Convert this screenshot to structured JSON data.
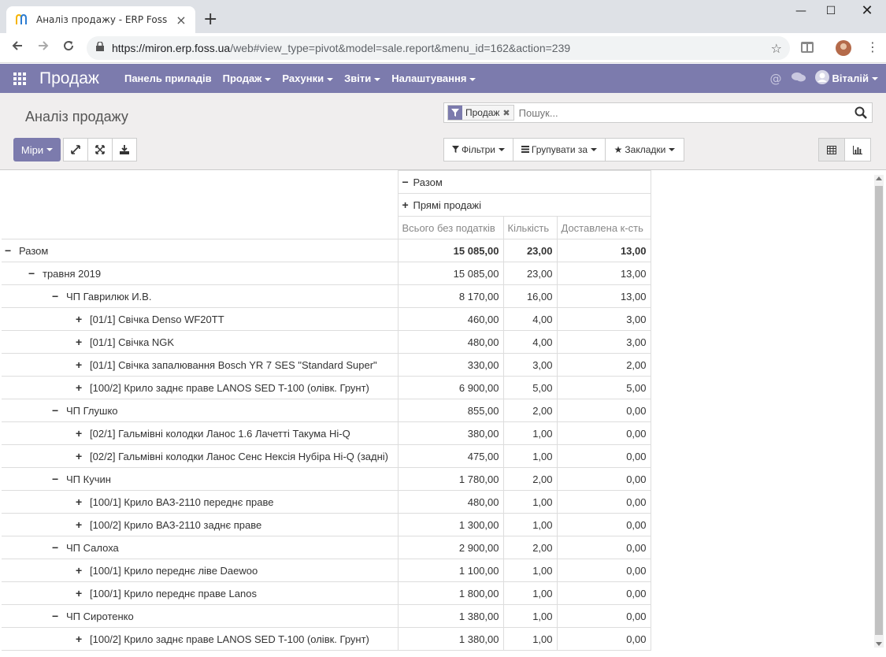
{
  "browser": {
    "tab_title": "Аналіз продажу - ERP Foss",
    "url_host": "https://miron.erp.foss.ua",
    "url_path": "/web#view_type=pivot&model=sale.report&menu_id=162&action=239"
  },
  "navbar": {
    "brand": "Продаж",
    "menu": [
      "Панель приладів",
      "Продаж",
      "Рахунки",
      "Звіти",
      "Налаштування"
    ],
    "user": "Віталій",
    "color": "#7c7bad"
  },
  "control_panel": {
    "breadcrumb": "Аналіз продажу",
    "facet": "Продаж",
    "search_placeholder": "Пошук...",
    "measures_label": "Міри",
    "filters_label": "Фільтри",
    "group_by_label": "Групувати за",
    "favorites_label": "Закладки"
  },
  "pivot": {
    "col_total": "Разом",
    "col_group": "Прямі продажі",
    "measures": [
      "Всього без податків",
      "Кількість",
      "Доставлена к-сть"
    ],
    "rows": [
      {
        "label": "Разом",
        "sign": "−",
        "values": [
          "15 085,00",
          "23,00",
          "13,00"
        ]
      },
      {
        "label": "травня 2019",
        "sign": "−",
        "values": [
          "15 085,00",
          "23,00",
          "13,00"
        ]
      },
      {
        "label": "ЧП Гаврилюк И.В.",
        "sign": "−",
        "values": [
          "8 170,00",
          "16,00",
          "13,00"
        ]
      },
      {
        "label": "[01/1] Свічка Denso WF20TT",
        "sign": "+",
        "values": [
          "460,00",
          "4,00",
          "3,00"
        ]
      },
      {
        "label": "[01/1] Свічка NGK",
        "sign": "+",
        "values": [
          "480,00",
          "4,00",
          "3,00"
        ]
      },
      {
        "label": "[01/1] Свічка запалювання Bosch YR 7 SES \"Standard Super\"",
        "sign": "+",
        "values": [
          "330,00",
          "3,00",
          "2,00"
        ]
      },
      {
        "label": "[100/2] Крило заднє праве LANOS SED T-100 (олівк. Грунт)",
        "sign": "+",
        "values": [
          "6 900,00",
          "5,00",
          "5,00"
        ]
      },
      {
        "label": "ЧП Глушко",
        "sign": "−",
        "values": [
          "855,00",
          "2,00",
          "0,00"
        ]
      },
      {
        "label": "[02/1] Гальмівні колодки Ланос 1.6 Лачетті Такума Hi-Q",
        "sign": "+",
        "values": [
          "380,00",
          "1,00",
          "0,00"
        ]
      },
      {
        "label": "[02/2] Гальмівні колодки Ланос Сенс Нексія Нубіра Hi-Q (задні)",
        "sign": "+",
        "values": [
          "475,00",
          "1,00",
          "0,00"
        ]
      },
      {
        "label": "ЧП Кучин",
        "sign": "−",
        "values": [
          "1 780,00",
          "2,00",
          "0,00"
        ]
      },
      {
        "label": "[100/1] Крило ВАЗ-2110 переднє праве",
        "sign": "+",
        "values": [
          "480,00",
          "1,00",
          "0,00"
        ]
      },
      {
        "label": "[100/2] Крило ВАЗ-2110 заднє праве",
        "sign": "+",
        "values": [
          "1 300,00",
          "1,00",
          "0,00"
        ]
      },
      {
        "label": "ЧП Салоха",
        "sign": "−",
        "values": [
          "2 900,00",
          "2,00",
          "0,00"
        ]
      },
      {
        "label": "[100/1] Крило переднє ліве Daewoo",
        "sign": "+",
        "values": [
          "1 100,00",
          "1,00",
          "0,00"
        ]
      },
      {
        "label": "[100/1] Крило переднє праве Lanos",
        "sign": "+",
        "values": [
          "1 800,00",
          "1,00",
          "0,00"
        ]
      },
      {
        "label": "ЧП Сиротенко",
        "sign": "−",
        "values": [
          "1 380,00",
          "1,00",
          "0,00"
        ]
      },
      {
        "label": "[100/2] Крило заднє праве LANOS SED T-100 (олівк. Грунт)",
        "sign": "+",
        "values": [
          "1 380,00",
          "1,00",
          "0,00"
        ]
      }
    ]
  }
}
